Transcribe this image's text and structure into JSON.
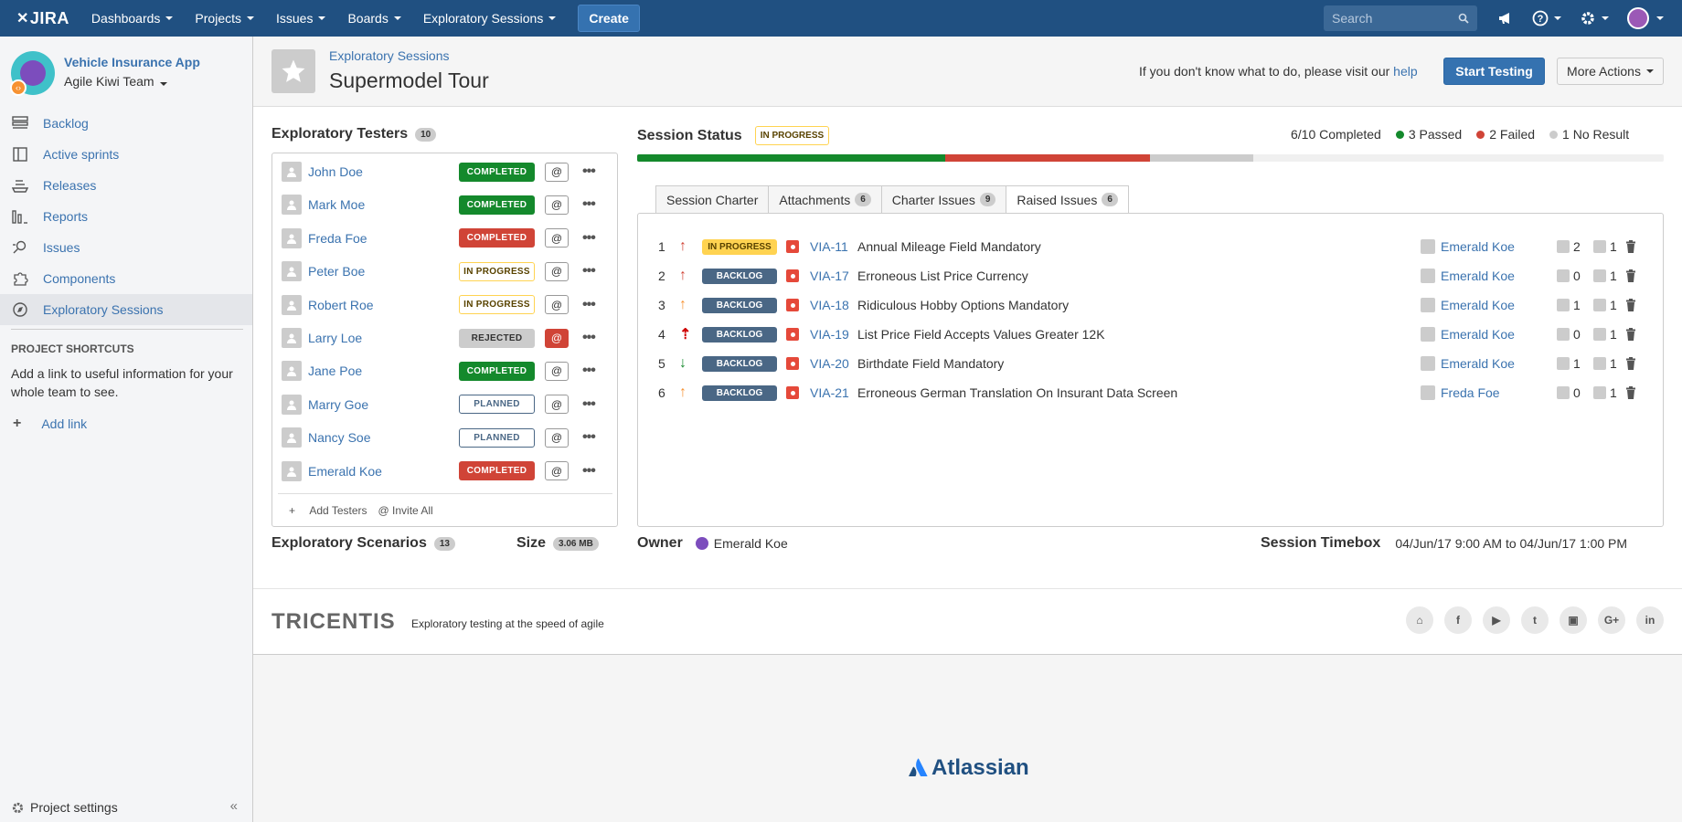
{
  "topnav": {
    "logo": "JIRA",
    "items": [
      "Dashboards",
      "Projects",
      "Issues",
      "Boards",
      "Exploratory Sessions"
    ],
    "create": "Create",
    "search_placeholder": "Search"
  },
  "sidebar": {
    "project_name": "Vehicle Insurance App",
    "team": "Agile Kiwi Team",
    "items": [
      {
        "label": "Backlog",
        "icon": "backlog-icon"
      },
      {
        "label": "Active sprints",
        "icon": "board-icon"
      },
      {
        "label": "Releases",
        "icon": "ship-icon"
      },
      {
        "label": "Reports",
        "icon": "chart-icon"
      },
      {
        "label": "Issues",
        "icon": "issues-icon"
      },
      {
        "label": "Components",
        "icon": "puzzle-icon"
      },
      {
        "label": "Exploratory Sessions",
        "icon": "compass-icon"
      }
    ],
    "shortcuts_title": "PROJECT SHORTCUTS",
    "shortcuts_text": "Add a link to useful information for your whole team to see.",
    "add_link": "Add link",
    "settings": "Project settings"
  },
  "header": {
    "breadcrumb": "Exploratory Sessions",
    "title": "Supermodel Tour",
    "help_prefix": "If you don't know what to do, please visit our",
    "help_link": "help",
    "start_button": "Start Testing",
    "more_button": "More Actions"
  },
  "testers": {
    "title": "Exploratory Testers",
    "count": "10",
    "rows": [
      {
        "name": "John Doe",
        "status": "COMPLETED",
        "kind": "completed",
        "at_red": false
      },
      {
        "name": "Mark Moe",
        "status": "COMPLETED",
        "kind": "completed",
        "at_red": false
      },
      {
        "name": "Freda Foe",
        "status": "COMPLETED",
        "kind": "failed",
        "at_red": false
      },
      {
        "name": "Peter Boe",
        "status": "IN PROGRESS",
        "kind": "inprog",
        "at_red": false
      },
      {
        "name": "Robert Roe",
        "status": "IN PROGRESS",
        "kind": "inprog",
        "at_red": false
      },
      {
        "name": "Larry Loe",
        "status": "REJECTED",
        "kind": "rejected",
        "at_red": true
      },
      {
        "name": "Jane Poe",
        "status": "COMPLETED",
        "kind": "completed",
        "at_red": false
      },
      {
        "name": "Marry Goe",
        "status": "PLANNED",
        "kind": "planned",
        "at_red": false
      },
      {
        "name": "Nancy Soe",
        "status": "PLANNED",
        "kind": "planned",
        "at_red": false
      },
      {
        "name": "Emerald Koe",
        "status": "COMPLETED",
        "kind": "failed",
        "at_red": false
      }
    ],
    "at_label": "@",
    "more_label": "•••",
    "add_testers": "Add Testers",
    "invite_all": "@ Invite All"
  },
  "scenarios": {
    "title": "Exploratory Scenarios",
    "count": "13"
  },
  "size": {
    "title": "Size",
    "value": "3.06 MB"
  },
  "session": {
    "title": "Session Status",
    "status": "IN PROGRESS",
    "completed": "6/10 Completed",
    "passed": "3 Passed",
    "failed": "2 Failed",
    "no_result": "1 No Result",
    "progress": {
      "passed": 0.3,
      "failed": 0.2,
      "no_result": 0.1
    },
    "colors": {
      "passed": "#14892c",
      "failed": "#d04437",
      "no_result": "#cccccc"
    }
  },
  "tabs": [
    {
      "label": "Session Charter",
      "count": null
    },
    {
      "label": "Attachments",
      "count": "6"
    },
    {
      "label": "Charter Issues",
      "count": "9"
    },
    {
      "label": "Raised Issues",
      "count": "6"
    }
  ],
  "issues": [
    {
      "num": "1",
      "prio": "↑",
      "prio_color": "#d04437",
      "status": "IN PROGRESS",
      "kind": "inprog",
      "key": "VIA-11",
      "summary": "Annual Mileage Field Mandatory",
      "assignee": "Emerald Koe",
      "c1": "2",
      "c2": "1"
    },
    {
      "num": "2",
      "prio": "↑",
      "prio_color": "#d04437",
      "status": "BACKLOG",
      "kind": "backlog",
      "key": "VIA-17",
      "summary": "Erroneous List Price Currency",
      "assignee": "Emerald Koe",
      "c1": "0",
      "c2": "1"
    },
    {
      "num": "3",
      "prio": "↑",
      "prio_color": "#f79232",
      "status": "BACKLOG",
      "kind": "backlog",
      "key": "VIA-18",
      "summary": "Ridiculous Hobby Options Mandatory",
      "assignee": "Emerald Koe",
      "c1": "1",
      "c2": "1"
    },
    {
      "num": "4",
      "prio": "⇡",
      "prio_color": "#ce0000",
      "status": "BACKLOG",
      "kind": "backlog",
      "key": "VIA-19",
      "summary": "List Price Field Accepts Values Greater 12K",
      "assignee": "Emerald Koe",
      "c1": "0",
      "c2": "1"
    },
    {
      "num": "5",
      "prio": "↓",
      "prio_color": "#14892c",
      "status": "BACKLOG",
      "kind": "backlog",
      "key": "VIA-20",
      "summary": "Birthdate Field Mandatory",
      "assignee": "Emerald Koe",
      "c1": "1",
      "c2": "1"
    },
    {
      "num": "6",
      "prio": "↑",
      "prio_color": "#f79232",
      "status": "BACKLOG",
      "kind": "backlog",
      "key": "VIA-21",
      "summary": "Erroneous German Translation On Insurant Data Screen",
      "assignee": "Freda Foe",
      "c1": "0",
      "c2": "1"
    }
  ],
  "owner": {
    "title": "Owner",
    "name": "Emerald Koe"
  },
  "timebox": {
    "title": "Session Timebox",
    "value": "04/Jun/17 9:00 AM to 04/Jun/17 1:00 PM"
  },
  "footer": {
    "brand": "TRICENTIS",
    "tagline": "Exploratory testing at the speed of agile",
    "socials": [
      "home-icon",
      "facebook-icon",
      "youtube-icon",
      "twitter-icon",
      "slideshare-icon",
      "google-plus-icon",
      "linkedin-icon"
    ],
    "atlassian": "Atlassian"
  }
}
